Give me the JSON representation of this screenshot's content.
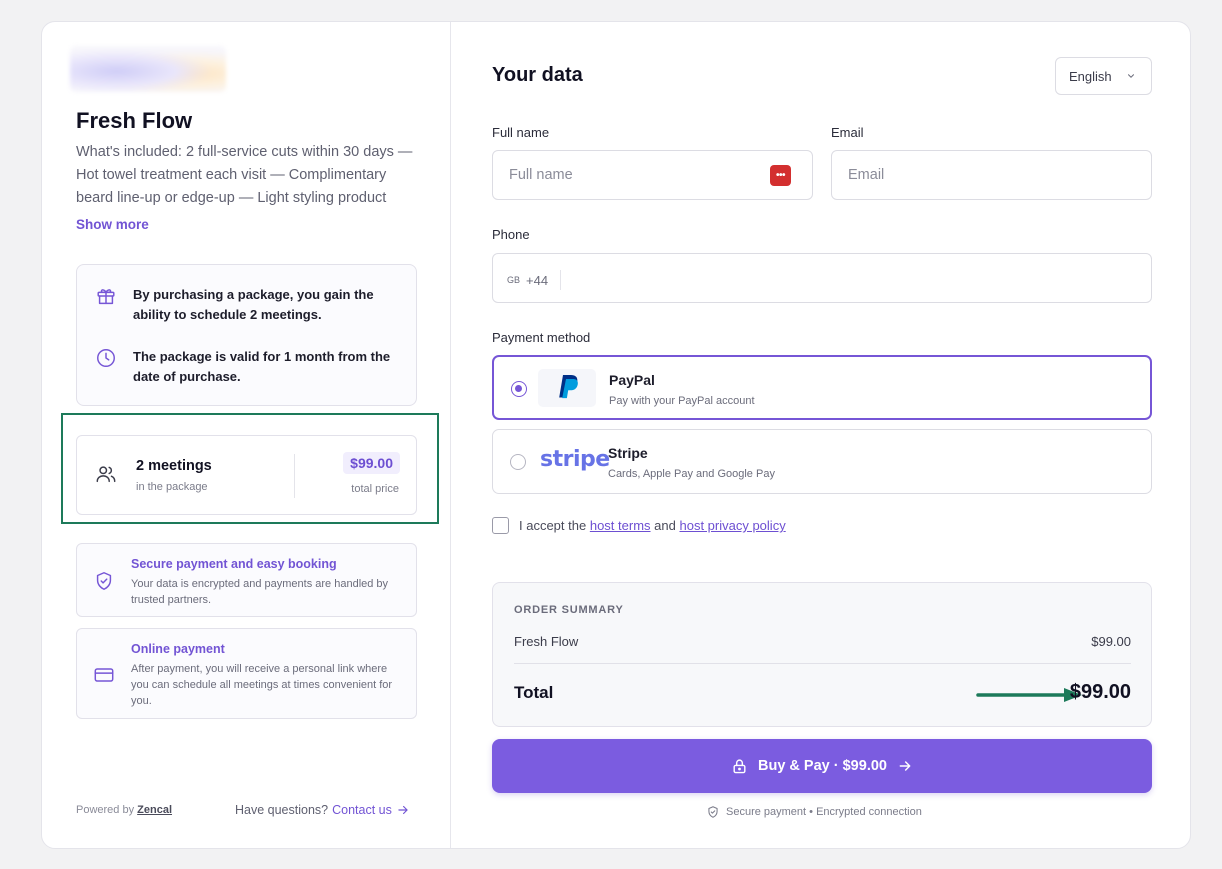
{
  "product": {
    "title": "Fresh Flow",
    "description": "What's included: 2 full-service cuts within 30 days — Hot towel treatment each visit — Complimentary beard line-up or edge-up — Light styling product",
    "show_more": "Show more"
  },
  "info": {
    "schedule_text": "By purchasing a package, you gain the ability to schedule 2 meetings.",
    "validity_text": "The package is valid for 1 month from the date of purchase."
  },
  "package": {
    "count": "2 meetings",
    "count_sub": "in the package",
    "price": "$99.00",
    "price_sub": "total price"
  },
  "features": [
    {
      "title": "Secure payment and easy booking",
      "desc": "Your data is encrypted and payments are handled by trusted partners.",
      "icon": "shield-check-icon"
    },
    {
      "title": "Online payment",
      "desc": "After payment, you will receive a personal link where you can schedule all meetings at times convenient for you.",
      "icon": "credit-card-icon"
    }
  ],
  "footer": {
    "powered_prefix": "Powered by",
    "powered_brand": "Zencal",
    "questions": "Have questions?",
    "contact": "Contact us"
  },
  "form": {
    "heading": "Your data",
    "language": "English",
    "full_name_label": "Full name",
    "full_name_placeholder": "Full name",
    "email_label": "Email",
    "email_placeholder": "Email",
    "phone_label": "Phone",
    "phone_country": "GB",
    "phone_code": "+44",
    "payment_label": "Payment method"
  },
  "payment_methods": [
    {
      "name": "PayPal",
      "desc": "Pay with your PayPal account",
      "selected": true
    },
    {
      "name": "Stripe",
      "desc": "Cards, Apple Pay and Google Pay",
      "logo_text": "stripe",
      "selected": false
    }
  ],
  "terms": {
    "prefix": "I accept the",
    "terms_link": "host terms",
    "and": "and",
    "privacy_link": "host privacy policy"
  },
  "summary": {
    "heading": "ORDER SUMMARY",
    "item_name": "Fresh Flow",
    "item_price": "$99.00",
    "total_label": "Total",
    "total_price": "$99.00"
  },
  "buy_button": "Buy & Pay · $99.00",
  "secure_note": "Secure payment • Encrypted connection",
  "colors": {
    "accent": "#7b5ce0",
    "highlight": "#1d7a5a",
    "paypal_dark": "#003087",
    "paypal_light": "#009cde",
    "stripe": "#6773e6"
  }
}
